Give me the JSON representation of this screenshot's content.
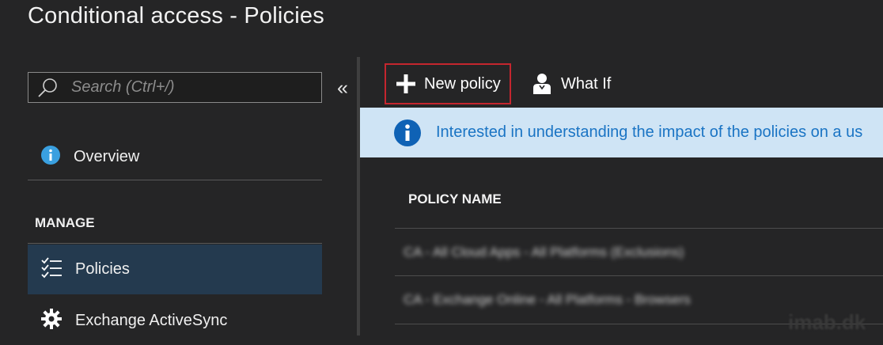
{
  "window": {
    "title": "Conditional access - Policies"
  },
  "sidebar": {
    "search_placeholder": "Search (Ctrl+/)",
    "collapse_glyph": "«",
    "overview_label": "Overview",
    "section_label": "MANAGE",
    "items": [
      {
        "label": "Policies",
        "icon": "checklist-icon",
        "selected": true
      },
      {
        "label": "Exchange ActiveSync",
        "icon": "gear-icon",
        "selected": false
      }
    ]
  },
  "toolbar": {
    "new_policy_label": "New policy",
    "what_if_label": "What If"
  },
  "info_banner": {
    "text": "Interested in understanding the impact of the policies on a us"
  },
  "table": {
    "columns": [
      "POLICY NAME"
    ],
    "rows": [
      "CA - All Cloud Apps - All Platforms (Exclusions)",
      "CA - Exchange Online - All Platforms - Browsers"
    ]
  },
  "watermark": "imab.dk",
  "colors": {
    "background": "#252526",
    "selected_item": "#243a4f",
    "info_bar": "#cfe4f5",
    "info_text": "#1a74c4",
    "highlight_border": "#c4262e"
  }
}
